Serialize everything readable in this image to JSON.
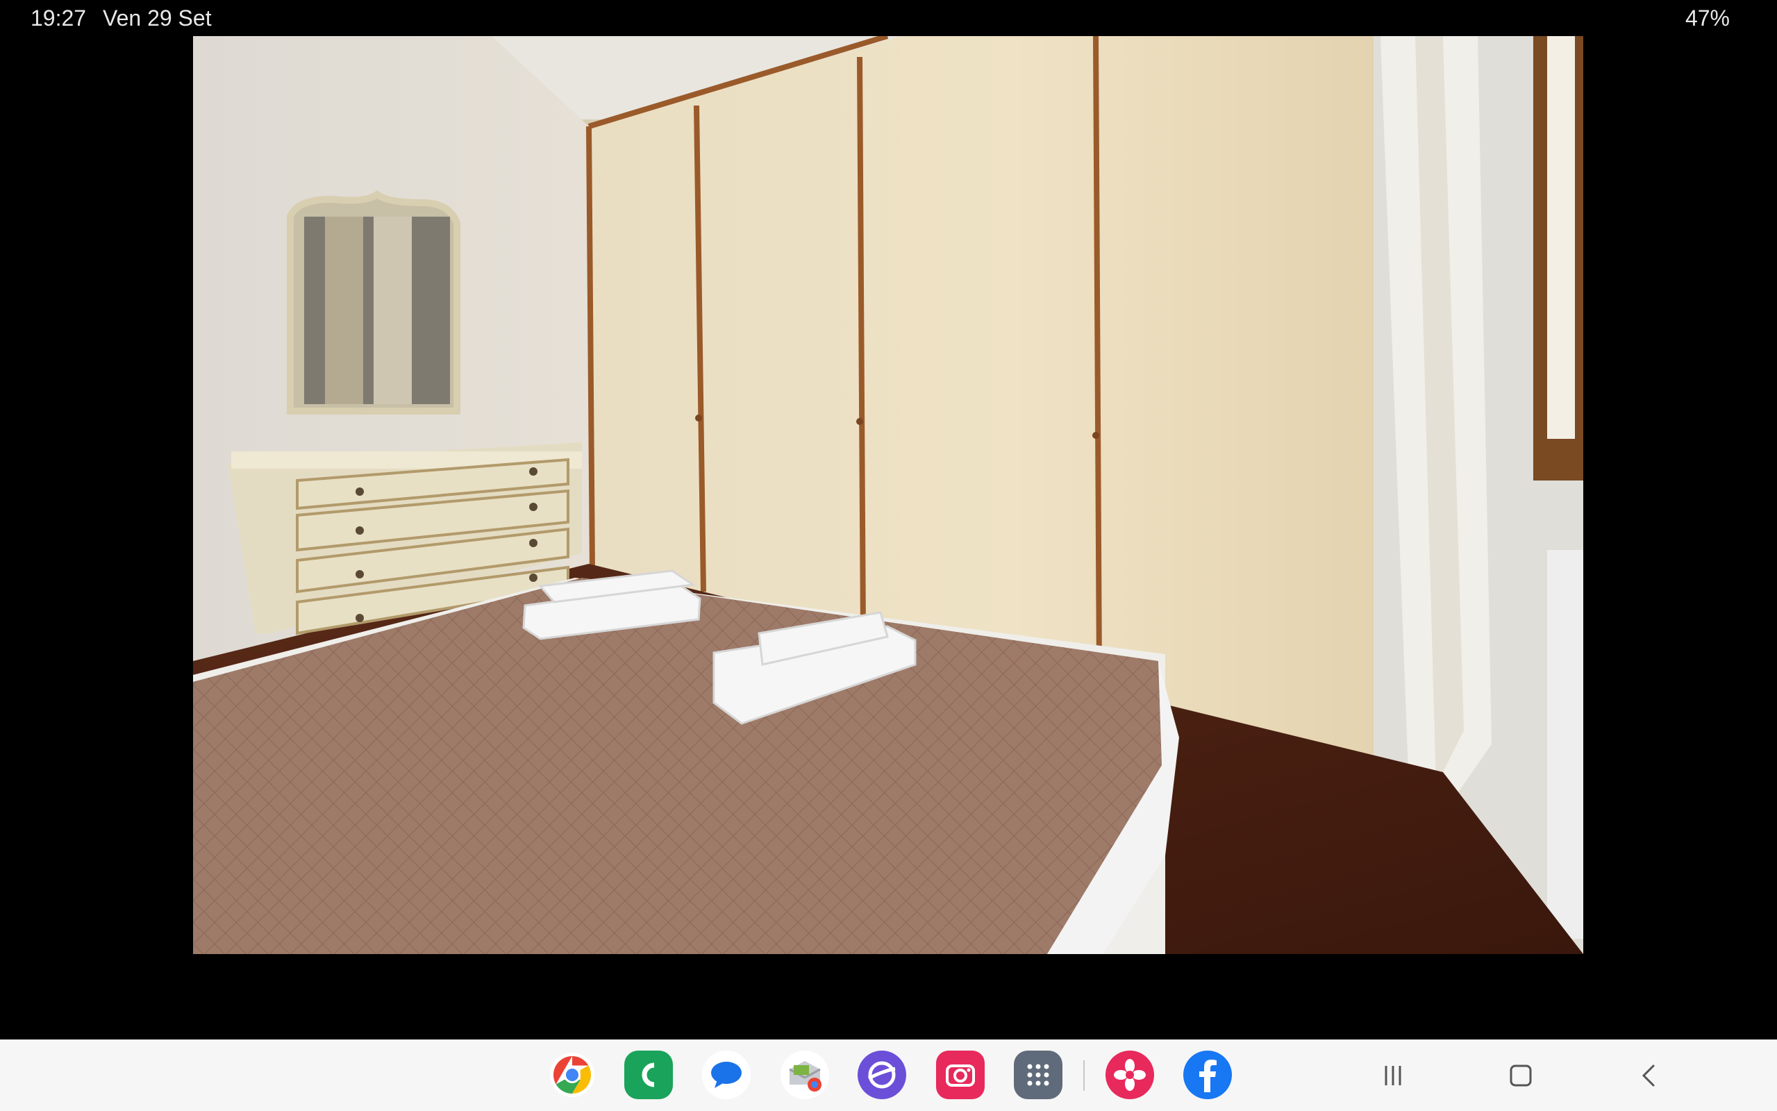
{
  "status_bar": {
    "time": "19:27",
    "date": "Ven 29 Set",
    "battery": "47%"
  },
  "viewer": {
    "image_alt": "Bedroom with wardrobe, dresser, mirror and bed with towels"
  },
  "taskbar": {
    "apps": [
      {
        "name": "chrome-icon",
        "color": "#4285f4"
      },
      {
        "name": "phone-icon",
        "color": "#1aa35a"
      },
      {
        "name": "messages-icon",
        "color": "#1a73e8"
      },
      {
        "name": "chrome-pwa-icon",
        "color": "#7cb342"
      },
      {
        "name": "samsung-internet-icon",
        "color": "#6b4fd8"
      },
      {
        "name": "camera-icon",
        "color": "#e8295b"
      },
      {
        "name": "app-drawer-icon",
        "color": "#5f6b7a"
      },
      {
        "name": "blossom-icon",
        "color": "#e8295b"
      },
      {
        "name": "facebook-icon",
        "color": "#1877f2"
      }
    ],
    "nav": [
      "recent-apps-icon",
      "home-icon",
      "back-icon"
    ]
  }
}
